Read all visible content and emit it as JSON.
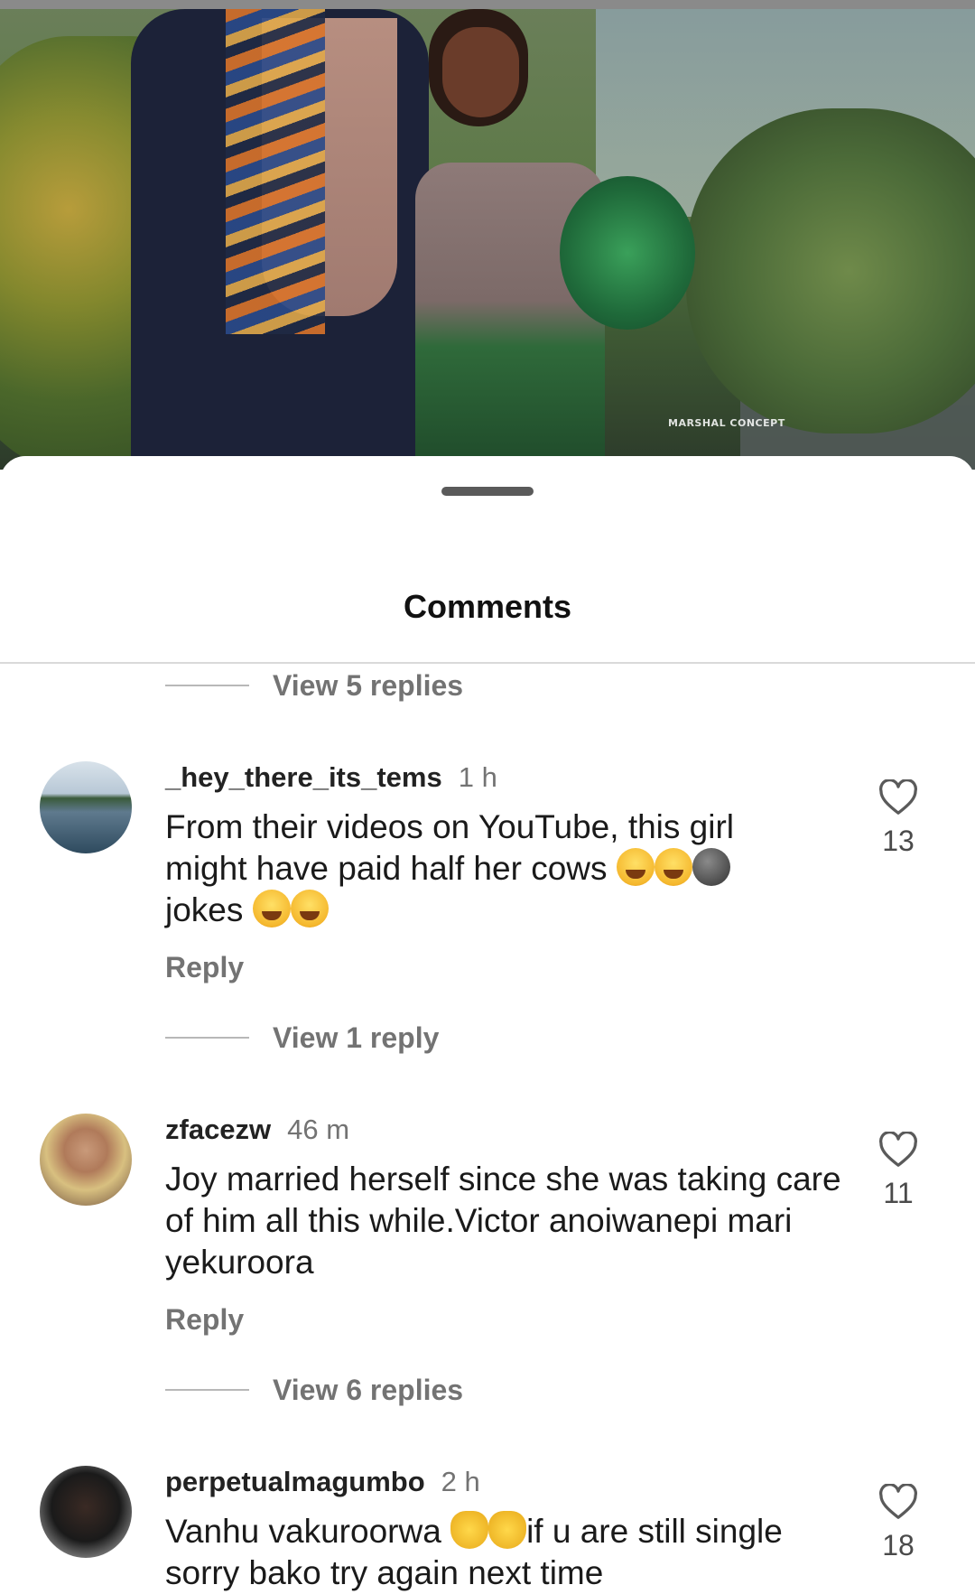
{
  "photo": {
    "watermark": "MARSHAL CONCEPT"
  },
  "sheet": {
    "title": "Comments"
  },
  "threads": [
    {
      "view_replies": "View 5 replies"
    },
    {
      "username": "_hey_there_its_tems",
      "time": "1 h",
      "text_line1": "From their videos on YouTube, this girl",
      "text_line2": "might have paid half her cows",
      "text_line3": "jokes",
      "reply": "Reply",
      "likes": "13",
      "view_replies": "View 1 reply"
    },
    {
      "username": "zfacezw",
      "time": "46 m",
      "text": "Joy married herself since she was taking care of him all this while.Victor anoiwanepi mari yekuroora",
      "reply": "Reply",
      "likes": "11",
      "view_replies": "View 6 replies"
    },
    {
      "username": "perpetualmagumbo",
      "time": "2 h",
      "text_start": "Vanhu vakuroorwa",
      "text_end": "if u are still single",
      "text_line2": "sorry bako try again next time",
      "likes": "18"
    }
  ],
  "icons": {
    "like": "heart-outline-icon",
    "emoji_laugh": "face-with-tears-of-joy-icon",
    "emoji_moon": "new-moon-face-icon",
    "emoji_clap": "clapping-hands-icon"
  },
  "colors": {
    "secondary_text": "#737373",
    "divider": "#d9d9d9"
  }
}
